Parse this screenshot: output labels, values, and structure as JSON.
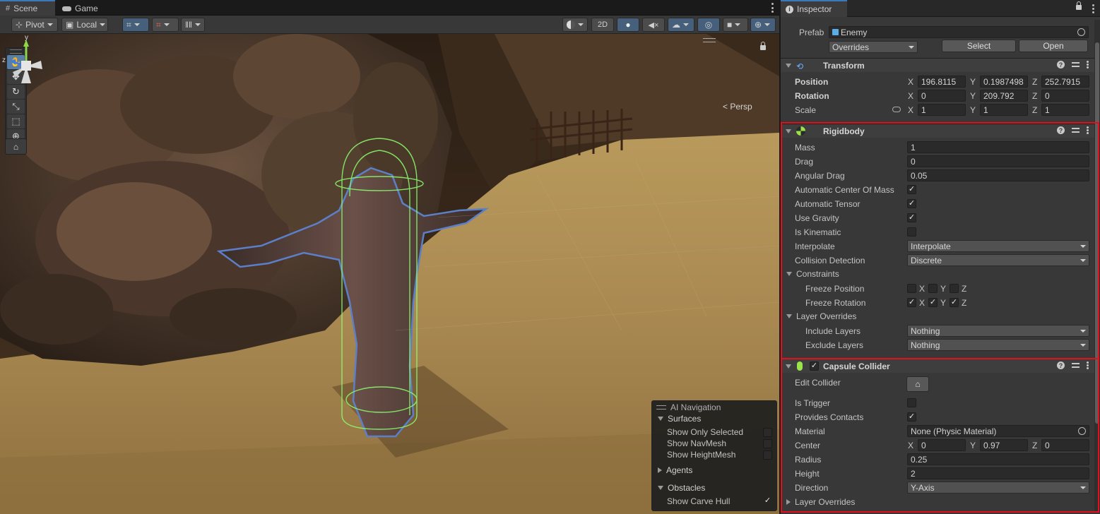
{
  "scene": {
    "tabs": [
      {
        "label": "Scene"
      },
      {
        "label": "Game"
      }
    ],
    "toolbar": {
      "pivot": "Pivot",
      "local": "Local",
      "btn_2d": "2D"
    },
    "persp": "< Persp",
    "gizmo_axes": {
      "y": "y",
      "z": "z"
    }
  },
  "ai_nav": {
    "title": "AI Navigation",
    "surfaces": "Surfaces",
    "show_only_selected": "Show Only Selected",
    "show_navmesh": "Show NavMesh",
    "show_heightmesh": "Show HeightMesh",
    "agents": "Agents",
    "obstacles": "Obstacles",
    "show_carve_hull": "Show Carve Hull",
    "show_carve_hull_checked": true
  },
  "inspector": {
    "tab": "Inspector",
    "prefab_label": "Prefab",
    "prefab_name": "Enemy",
    "overrides": "Overrides",
    "select": "Select",
    "open": "Open",
    "transform": {
      "title": "Transform",
      "position_label": "Position",
      "rotation_label": "Rotation",
      "scale_label": "Scale",
      "position": {
        "x": "196.8115",
        "y": "0.1987498",
        "z": "252.7915"
      },
      "rotation": {
        "x": "0",
        "y": "209.792",
        "z": "0"
      },
      "scale": {
        "x": "1",
        "y": "1",
        "z": "1"
      }
    },
    "rigidbody": {
      "title": "Rigidbody",
      "mass_label": "Mass",
      "mass": "1",
      "drag_label": "Drag",
      "drag": "0",
      "angular_drag_label": "Angular Drag",
      "angular_drag": "0.05",
      "auto_com_label": "Automatic Center Of Mass",
      "auto_tensor_label": "Automatic Tensor",
      "use_gravity_label": "Use Gravity",
      "is_kinematic_label": "Is Kinematic",
      "interpolate_label": "Interpolate",
      "interpolate": "Interpolate",
      "collision_label": "Collision Detection",
      "collision": "Discrete",
      "constraints_label": "Constraints",
      "freeze_pos_label": "Freeze Position",
      "freeze_rot_label": "Freeze Rotation",
      "layer_overrides_label": "Layer Overrides",
      "include_label": "Include Layers",
      "include": "Nothing",
      "exclude_label": "Exclude Layers",
      "exclude": "Nothing"
    },
    "capsule": {
      "title": "Capsule Collider",
      "edit_label": "Edit Collider",
      "is_trigger_label": "Is Trigger",
      "provides_contacts_label": "Provides Contacts",
      "material_label": "Material",
      "material": "None (Physic Material)",
      "center_label": "Center",
      "center": {
        "x": "0",
        "y": "0.97",
        "z": "0"
      },
      "radius_label": "Radius",
      "radius": "0.25",
      "height_label": "Height",
      "height": "2",
      "direction_label": "Direction",
      "direction": "Y-Axis",
      "layer_overrides_label": "Layer Overrides"
    },
    "axis": {
      "x": "X",
      "y": "Y",
      "z": "Z"
    }
  },
  "colors": {
    "highlight_border": "#e3101a",
    "accent": "#3a79bb",
    "collider_green": "#8cff70"
  }
}
